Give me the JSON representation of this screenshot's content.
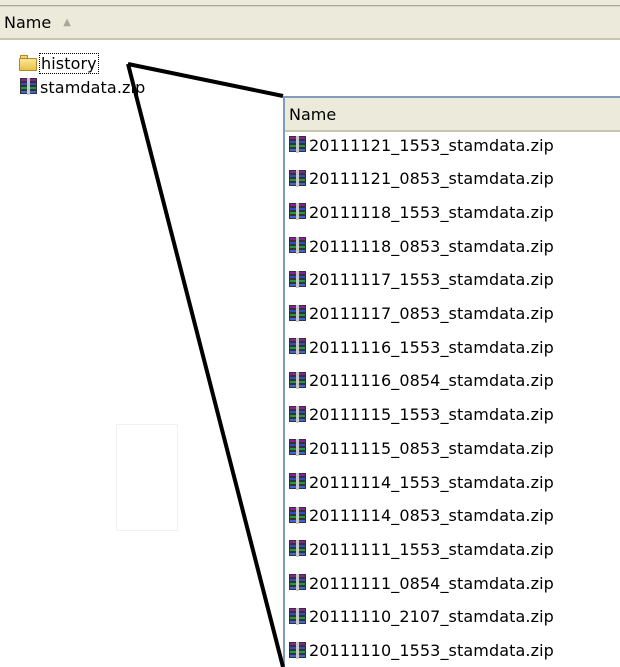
{
  "outer_pane": {
    "column_header": "Name",
    "items": [
      {
        "name": "history",
        "icon": "folder-icon",
        "selected": true
      },
      {
        "name": "stamdata.zip",
        "icon": "zip-archive-icon",
        "selected": false
      }
    ]
  },
  "inner_pane": {
    "column_header": "Name",
    "items": [
      {
        "name": "20111121_1553_stamdata.zip",
        "icon": "zip-archive-icon"
      },
      {
        "name": "20111121_0853_stamdata.zip",
        "icon": "zip-archive-icon"
      },
      {
        "name": "20111118_1553_stamdata.zip",
        "icon": "zip-archive-icon"
      },
      {
        "name": "20111118_0853_stamdata.zip",
        "icon": "zip-archive-icon"
      },
      {
        "name": "20111117_1553_stamdata.zip",
        "icon": "zip-archive-icon"
      },
      {
        "name": "20111117_0853_stamdata.zip",
        "icon": "zip-archive-icon"
      },
      {
        "name": "20111116_1553_stamdata.zip",
        "icon": "zip-archive-icon"
      },
      {
        "name": "20111116_0854_stamdata.zip",
        "icon": "zip-archive-icon"
      },
      {
        "name": "20111115_1553_stamdata.zip",
        "icon": "zip-archive-icon"
      },
      {
        "name": "20111115_0853_stamdata.zip",
        "icon": "zip-archive-icon"
      },
      {
        "name": "20111114_1553_stamdata.zip",
        "icon": "zip-archive-icon"
      },
      {
        "name": "20111114_0853_stamdata.zip",
        "icon": "zip-archive-icon"
      },
      {
        "name": "20111111_1553_stamdata.zip",
        "icon": "zip-archive-icon"
      },
      {
        "name": "20111111_0854_stamdata.zip",
        "icon": "zip-archive-icon"
      },
      {
        "name": "20111110_2107_stamdata.zip",
        "icon": "zip-archive-icon"
      },
      {
        "name": "20111110_1553_stamdata.zip",
        "icon": "zip-archive-icon"
      }
    ]
  }
}
